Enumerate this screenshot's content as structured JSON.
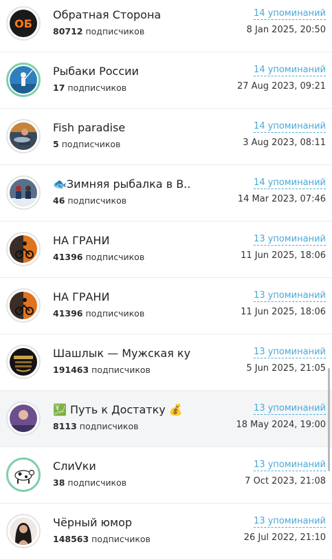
{
  "channels": [
    {
      "title": "Обратная Сторона",
      "subscribers": "80712",
      "subscribers_label": "подписчиков",
      "mentions": "14 упоминаний",
      "date": "8 Jan 2025, 20:50",
      "avatar_icon": "ob-logo-icon"
    },
    {
      "title": "Рыбаки России",
      "subscribers": "17",
      "subscribers_label": "подписчиков",
      "mentions": "14 упоминаний",
      "date": "27 Aug 2023, 09:21",
      "avatar_icon": "fisherman-icon"
    },
    {
      "title": "Fish paradise",
      "subscribers": "5",
      "subscribers_label": "подписчиков",
      "mentions": "14 упоминаний",
      "date": "3 Aug 2023, 08:11",
      "avatar_icon": "fish-photo-icon"
    },
    {
      "title": "🐟Зимняя рыбалка в В...",
      "subscribers": "46",
      "subscribers_label": "подписчиков",
      "mentions": "14 упоминаний",
      "date": "14 Mar 2023, 07:46",
      "avatar_icon": "winter-fishing-icon"
    },
    {
      "title": "НА ГРАНИ",
      "subscribers": "41396",
      "subscribers_label": "подписчиков",
      "mentions": "13 упоминаний",
      "date": "11 Jun 2025, 18:06",
      "avatar_icon": "motorcycle-icon"
    },
    {
      "title": "НА ГРАНИ",
      "subscribers": "41396",
      "subscribers_label": "подписчиков",
      "mentions": "13 упоминаний",
      "date": "11 Jun 2025, 18:06",
      "avatar_icon": "motorcycle-icon"
    },
    {
      "title": "Шашлык — Мужская ку...",
      "subscribers": "191463",
      "subscribers_label": "подписчиков",
      "mentions": "13 упоминаний",
      "date": "5 Jun 2025, 21:05",
      "avatar_icon": "grill-logo-icon"
    },
    {
      "title": "💹 Путь к Достатку 💰",
      "subscribers": "8113",
      "subscribers_label": "подписчиков",
      "mentions": "13 упоминаний",
      "date": "18 May 2024, 19:00",
      "avatar_icon": "money-portrait-icon"
    },
    {
      "title": "СлиVки",
      "subscribers": "38",
      "subscribers_label": "подписчиков",
      "mentions": "13 упоминаний",
      "date": "7 Oct 2023, 21:08",
      "avatar_icon": "cow-icon"
    },
    {
      "title": "Чёрный юмор",
      "subscribers": "148563",
      "subscribers_label": "подписчиков",
      "mentions": "13 упоминаний",
      "date": "26 Jul 2022, 21:10",
      "avatar_icon": "portrait-icon"
    }
  ],
  "colors": {
    "accent_link": "#4aa8d8",
    "highlight_row": "#f4f5f7",
    "green_ring": "#7ecfa9"
  }
}
